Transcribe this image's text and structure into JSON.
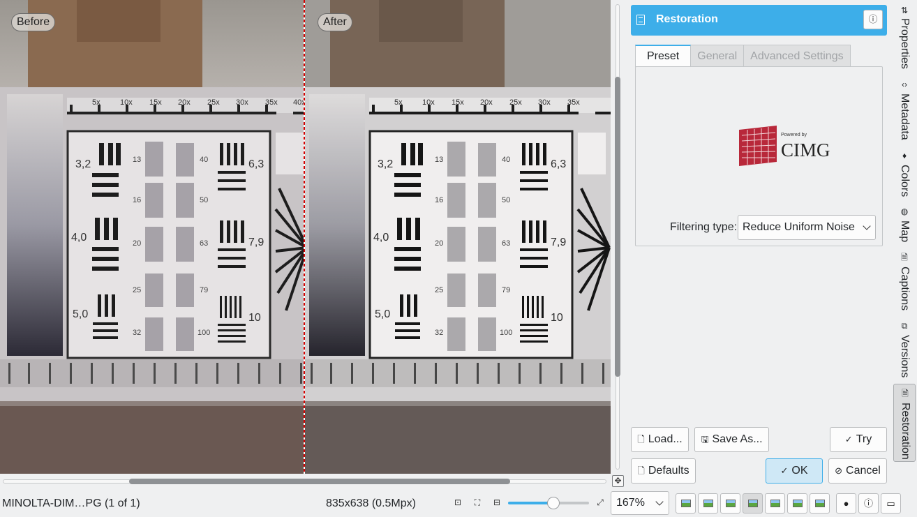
{
  "preview": {
    "before_label": "Before",
    "after_label": "After",
    "chart_numbers": [
      "3,2",
      "6,3",
      "4,0",
      "7,9",
      "5,0",
      "10"
    ],
    "chart_column_numbers": [
      "13",
      "16",
      "20",
      "25",
      "32"
    ],
    "chart_column_numbers_2": [
      "40",
      "50",
      "63",
      "79",
      "100"
    ],
    "chart_ruler_labels": [
      "5x",
      "10x",
      "15x",
      "20x",
      "25x",
      "30x",
      "35x",
      "40x"
    ]
  },
  "panel": {
    "title": "Restoration",
    "tabs": [
      "Preset",
      "General",
      "Advanced Settings"
    ],
    "logo_small_text": "Powered by",
    "logo_text": "CIMG",
    "filter_label": "Filtering type:",
    "filter_value": "Reduce Uniform Noise",
    "buttons": {
      "load": "Load...",
      "save_as": "Save As...",
      "try": "Try",
      "defaults": "Defaults",
      "ok": "OK",
      "cancel": "Cancel"
    }
  },
  "sidebar": [
    "Properties",
    "Metadata",
    "Colors",
    "Map",
    "Captions",
    "Versions",
    "Restoration"
  ],
  "status": {
    "file": "MINOLTA-DIM…PG (1 of 1)",
    "dimensions": "835x638 (0.5Mpx)",
    "zoom_value": "167%",
    "zoom_slider_fraction": 0.57
  },
  "colors": {
    "accent": "#3daee9",
    "divider": "#d40000"
  }
}
